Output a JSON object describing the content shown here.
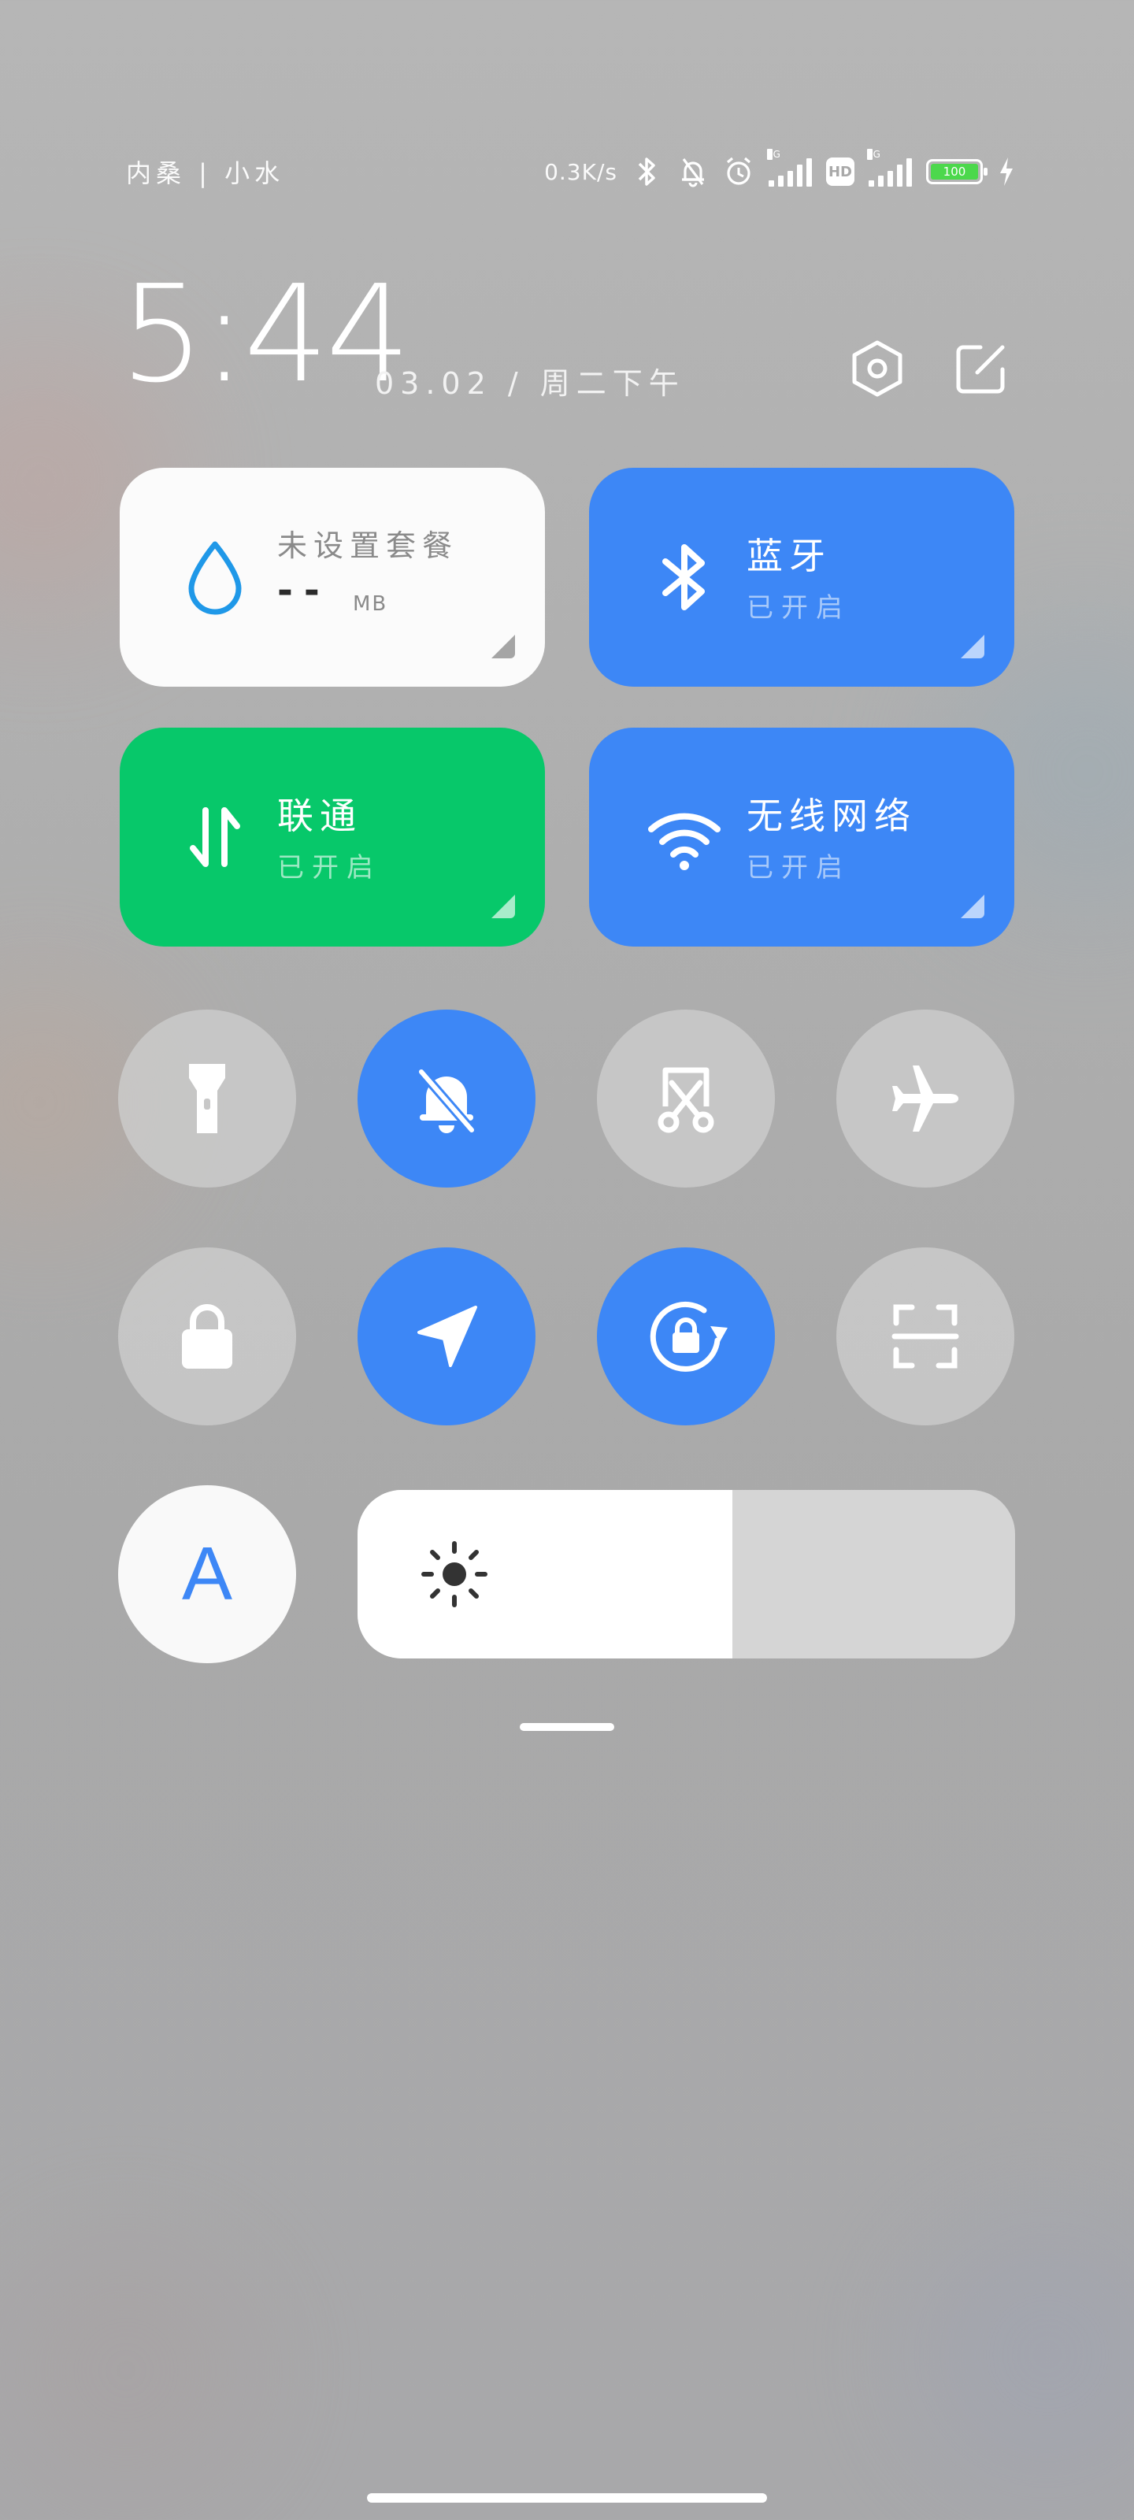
{
  "status_bar": {
    "carrier": "内桑 | 小水",
    "net_speed": "0.3K/s",
    "icons": [
      "bluetooth-icon",
      "mute-icon",
      "alarm-icon",
      "signal-5g-icon",
      "hd-icon",
      "signal-4g-icon",
      "battery-icon",
      "charging-icon"
    ],
    "sim1_tag": "5G",
    "sim2_tag": "4G",
    "hd_label": "HD",
    "battery_level": "100"
  },
  "header": {
    "time": "5:44",
    "date": "03.02 / 周二下午",
    "settings_icon": "hexagon-settings-icon",
    "edit_icon": "edit-icon"
  },
  "tiles": {
    "data_plan": {
      "title": "未设置套餐",
      "value": "--",
      "unit": "MB",
      "icon": "water-drop-icon"
    },
    "bluetooth": {
      "title": "蓝牙",
      "status": "已开启",
      "icon": "bluetooth-icon"
    },
    "mobile_data": {
      "title": "联通",
      "status": "已开启",
      "icon": "data-transfer-icon"
    },
    "wifi": {
      "title": "无线网络",
      "status": "已开启",
      "icon": "wifi-icon"
    }
  },
  "toggles": [
    {
      "name": "flashlight",
      "icon": "flashlight-icon",
      "on": false
    },
    {
      "name": "mute",
      "icon": "bell-off-icon",
      "on": true
    },
    {
      "name": "screenshot",
      "icon": "screenshot-scissors-icon",
      "on": false
    },
    {
      "name": "airplane",
      "icon": "airplane-icon",
      "on": false
    },
    {
      "name": "lock",
      "icon": "lock-icon",
      "on": false
    },
    {
      "name": "location",
      "icon": "location-arrow-icon",
      "on": true
    },
    {
      "name": "rotation-lock",
      "icon": "rotation-lock-icon",
      "on": true
    },
    {
      "name": "scan",
      "icon": "scan-icon",
      "on": false
    }
  ],
  "auto_brightness": {
    "label": "A",
    "icon": "auto-brightness-icon"
  },
  "brightness": {
    "level": 0.57,
    "icon": "sun-icon"
  },
  "colors": {
    "accent": "#3d87f6",
    "green": "#07c86a",
    "tile_white": "#fbfbfb"
  }
}
